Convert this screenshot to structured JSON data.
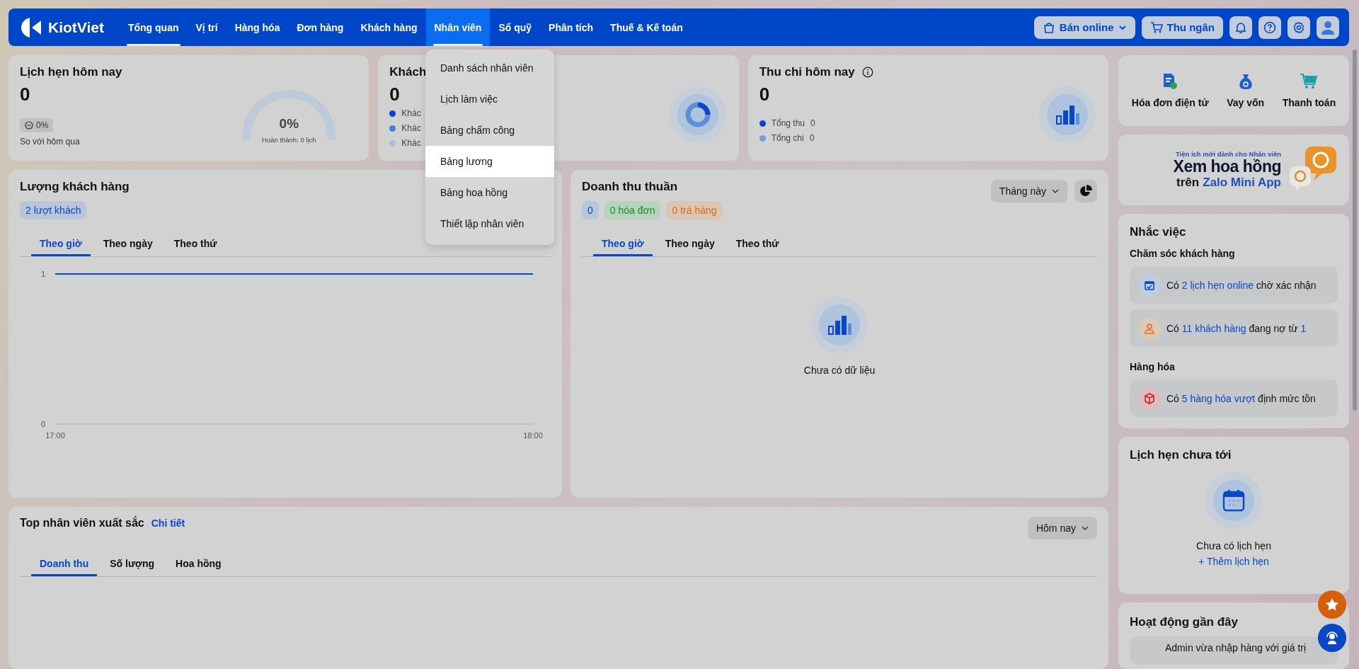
{
  "nav": {
    "logo": "KiotViet",
    "items": [
      {
        "label": "Tổng quan",
        "selected": true,
        "open": false
      },
      {
        "label": "Vị trí",
        "selected": false,
        "open": false
      },
      {
        "label": "Hàng hóa",
        "selected": false,
        "open": false
      },
      {
        "label": "Đơn hàng",
        "selected": false,
        "open": false
      },
      {
        "label": "Khách hàng",
        "selected": false,
        "open": false
      },
      {
        "label": "Nhân viên",
        "selected": true,
        "open": true
      },
      {
        "label": "Sổ quỹ",
        "selected": false,
        "open": false
      },
      {
        "label": "Phân tích",
        "selected": false,
        "open": false
      },
      {
        "label": "Thuế & Kế toán",
        "selected": false,
        "open": false
      }
    ],
    "online_button": "Bán online",
    "cashier_button": "Thu ngân"
  },
  "staff_menu": [
    {
      "label": "Danh sách nhân viên",
      "selected": false
    },
    {
      "label": "Lịch làm việc",
      "selected": false
    },
    {
      "label": "Bảng chấm công",
      "selected": false
    },
    {
      "label": "Bảng lương",
      "selected": true
    },
    {
      "label": "Bảng hoa hồng",
      "selected": false
    },
    {
      "label": "Thiết lập nhân viên",
      "selected": false
    }
  ],
  "appointments_today": {
    "title": "Lịch hẹn hôm nay",
    "value": "0",
    "change": "0%",
    "compare": "So với hôm qua",
    "gauge_value": "0%",
    "gauge_caption": "Hoàn thành: 0 lịch"
  },
  "customers_today": {
    "title": "Khách",
    "value": "0",
    "legend": [
      {
        "label": "Khác",
        "color": "#0a47c8"
      },
      {
        "label": "Khác",
        "color": "#3f80d8"
      },
      {
        "label": "Khác",
        "color": "#a8bedd"
      }
    ]
  },
  "cashflow_today": {
    "title": "Thu chi hôm nay",
    "value": "0",
    "legend": [
      {
        "label": "Tổng thu",
        "value": "0",
        "color": "#0a47c8"
      },
      {
        "label": "Tổng chi",
        "value": "0",
        "color": "#6f9fdc"
      }
    ]
  },
  "customer_traffic": {
    "title": "Lượng khách hàng",
    "badge": "2 lượt khách",
    "tabs": [
      {
        "label": "Theo giờ",
        "selected": true
      },
      {
        "label": "Theo ngày",
        "selected": false
      },
      {
        "label": "Theo thứ",
        "selected": false
      }
    ],
    "chart_data": {
      "type": "line",
      "x": [
        "17:00",
        "18:00"
      ],
      "series": [
        {
          "color": "#0a47c8",
          "values": [
            1,
            1
          ]
        }
      ],
      "ylim": [
        0,
        1
      ],
      "yticks": [
        0,
        1
      ]
    }
  },
  "net_revenue": {
    "title": "Doanh thu thuần",
    "badges": [
      {
        "label": "0",
        "kind": "total"
      },
      {
        "label": "0 hóa đơn",
        "kind": "invoice"
      },
      {
        "label": "0 trả hàng",
        "kind": "return"
      }
    ],
    "period": "Tháng này",
    "tabs": [
      {
        "label": "Theo giờ",
        "selected": true
      },
      {
        "label": "Theo ngày",
        "selected": false
      },
      {
        "label": "Theo thứ",
        "selected": false
      }
    ],
    "empty": "Chưa có dữ liệu"
  },
  "top_staff": {
    "title": "Top nhân viên xuất sắc",
    "link": "Chi tiết",
    "period": "Hôm nay",
    "tabs": [
      {
        "label": "Doanh thu",
        "selected": true
      },
      {
        "label": "Số lượng",
        "selected": false
      },
      {
        "label": "Hoa hồng",
        "selected": false
      }
    ]
  },
  "services": [
    {
      "label": "Hóa đơn điện tử",
      "kind": "invoice"
    },
    {
      "label": "Vay vốn",
      "kind": "loan"
    },
    {
      "label": "Thanh toán",
      "kind": "payment"
    }
  ],
  "banner": {
    "kicker": "Tiện ích mới dành cho Nhân viên",
    "headline": "Xem hoa hồng",
    "line2_prefix": "trên",
    "line2_highlight": "Zalo Mini App"
  },
  "reminders": {
    "title": "Nhắc việc",
    "groups": [
      {
        "title": "Chăm sóc khách hàng",
        "items": [
          {
            "kind": "calendar",
            "parts": [
              {
                "text": "Có ",
                "link": false
              },
              {
                "text": "2 lịch hẹn online",
                "link": true
              },
              {
                "text": " chờ xác nhận",
                "link": false
              }
            ]
          },
          {
            "kind": "person",
            "parts": [
              {
                "text": "Có ",
                "link": false
              },
              {
                "text": "11 khách hàng",
                "link": true
              },
              {
                "text": " đang nợ từ ",
                "link": false
              },
              {
                "text": "1",
                "link": true
              }
            ]
          }
        ]
      },
      {
        "title": "Hàng hóa",
        "items": [
          {
            "kind": "box",
            "parts": [
              {
                "text": "Có ",
                "link": false
              },
              {
                "text": "5 hàng hóa vượt",
                "link": true
              },
              {
                "text": " định mức tồn",
                "link": false
              }
            ]
          }
        ]
      }
    ]
  },
  "upcoming": {
    "title": "Lịch hẹn chưa tới",
    "empty": "Chưa có lịch hẹn",
    "add": "+ Thêm lịch hẹn"
  },
  "recent": {
    "title": "Hoạt động gần đây",
    "items": [
      "Admin vừa nhập hàng với giá trị"
    ]
  }
}
